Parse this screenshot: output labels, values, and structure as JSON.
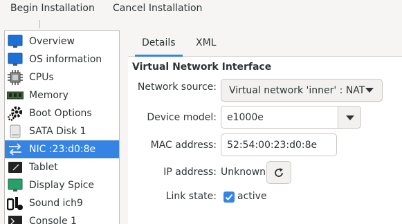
{
  "toolbar": {
    "begin_label": "Begin Installation",
    "cancel_label": "Cancel Installation"
  },
  "sidebar": {
    "items": [
      {
        "label": "Overview",
        "icon": "monitor-icon"
      },
      {
        "label": "OS information",
        "icon": "monitor-icon"
      },
      {
        "label": "CPUs",
        "icon": "cpu-icon"
      },
      {
        "label": "Memory",
        "icon": "memory-icon"
      },
      {
        "label": "Boot Options",
        "icon": "gear-icon"
      },
      {
        "label": "SATA Disk 1",
        "icon": "disk-icon"
      },
      {
        "label": "NIC :23:d0:8e",
        "icon": "network-icon",
        "selected": true
      },
      {
        "label": "Tablet",
        "icon": "tablet-icon"
      },
      {
        "label": "Display Spice",
        "icon": "display-icon"
      },
      {
        "label": "Sound ich9",
        "icon": "sound-icon"
      },
      {
        "label": "Console 1",
        "icon": "console-icon"
      }
    ]
  },
  "tabs": [
    {
      "label": "Details",
      "active": true
    },
    {
      "label": "XML",
      "active": false
    }
  ],
  "details": {
    "section_title": "Virtual Network Interface",
    "network_source_label": "Network source:",
    "network_source_value": "Virtual network 'inner' : NAT",
    "device_model_label": "Device model:",
    "device_model_value": "e1000e",
    "mac_label": "MAC address:",
    "mac_value": "52:54:00:23:d0:8e",
    "ip_label": "IP address:",
    "ip_value": "Unknown",
    "link_label": "Link state:",
    "link_value": "active",
    "link_checked": true
  },
  "colors": {
    "accent": "#3584e4",
    "selected_text": "#ffffff",
    "text": "#2e3436"
  }
}
